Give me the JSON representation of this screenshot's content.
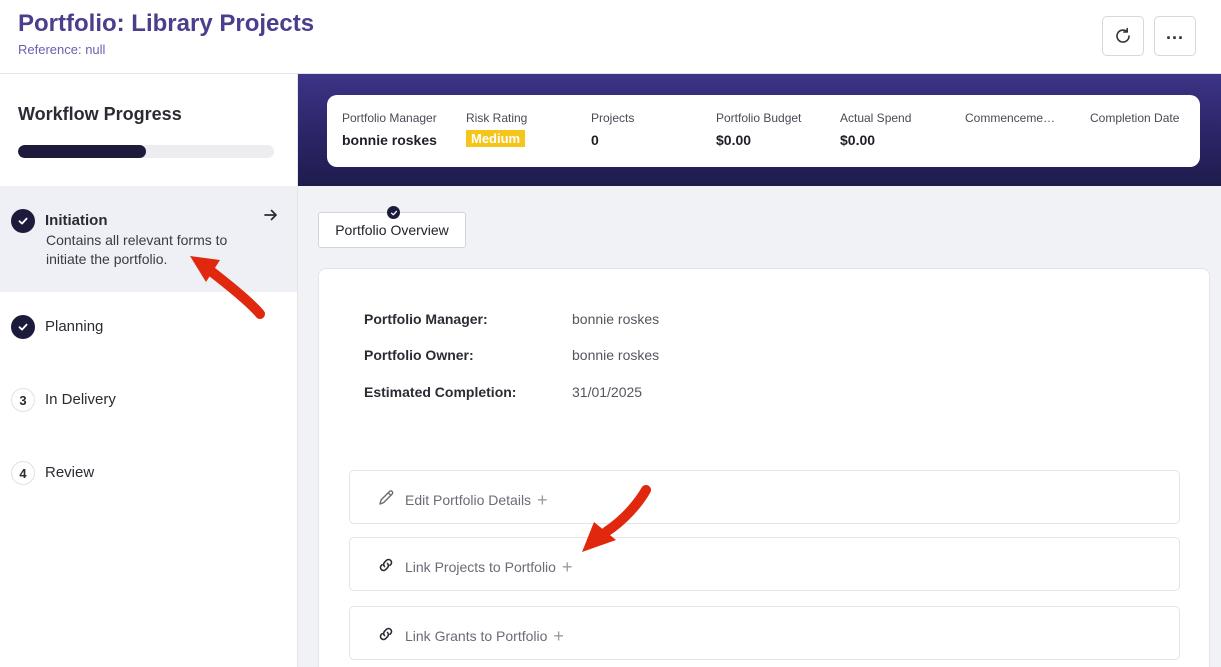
{
  "header": {
    "title": "Portfolio: Library Projects",
    "reference": "Reference: null",
    "refresh_icon": "refresh-icon",
    "more_icon": "more-icon",
    "more_glyph": "..."
  },
  "sidebar": {
    "title": "Workflow Progress",
    "progress_fraction": 0.5,
    "stages": [
      {
        "label": "Initiation",
        "status": "complete",
        "description": "Contains all relevant forms to initiate the portfolio.",
        "active": true
      },
      {
        "label": "Planning",
        "status": "complete"
      },
      {
        "label": "In Delivery",
        "status": "pending",
        "number": "3"
      },
      {
        "label": "Review",
        "status": "pending",
        "number": "4"
      }
    ]
  },
  "summary": {
    "items": [
      {
        "label": "Portfolio Manager",
        "value": "bonnie roskes"
      },
      {
        "label": "Risk Rating",
        "value": "Medium"
      },
      {
        "label": "Projects",
        "value": "0"
      },
      {
        "label": "Portfolio Budget",
        "value": "$0.00"
      },
      {
        "label": "Actual Spend",
        "value": "$0.00"
      },
      {
        "label": "Commencement Date",
        "value": ""
      },
      {
        "label": "Completion Date",
        "value": ""
      }
    ],
    "risk_color": "#f5c51c"
  },
  "tabs": [
    {
      "label": "Portfolio Overview",
      "selected": true
    }
  ],
  "overview": {
    "fields": [
      {
        "label": "Portfolio Manager:",
        "value": "bonnie roskes"
      },
      {
        "label": "Portfolio Owner:",
        "value": "bonnie roskes"
      },
      {
        "label": "Estimated Completion:",
        "value": "31/01/2025"
      }
    ],
    "actions": [
      {
        "label": "Edit Portfolio Details",
        "icon": "pencil-icon"
      },
      {
        "label": "Link Projects to Portfolio",
        "icon": "link-icon"
      },
      {
        "label": "Link Grants to Portfolio",
        "icon": "link-icon"
      }
    ],
    "plus_glyph": "+"
  },
  "colors": {
    "title": "#4a3f8e",
    "banner": "#2b2566",
    "dark_badge": "#1d1b3c",
    "annotation": "#e0280f"
  }
}
